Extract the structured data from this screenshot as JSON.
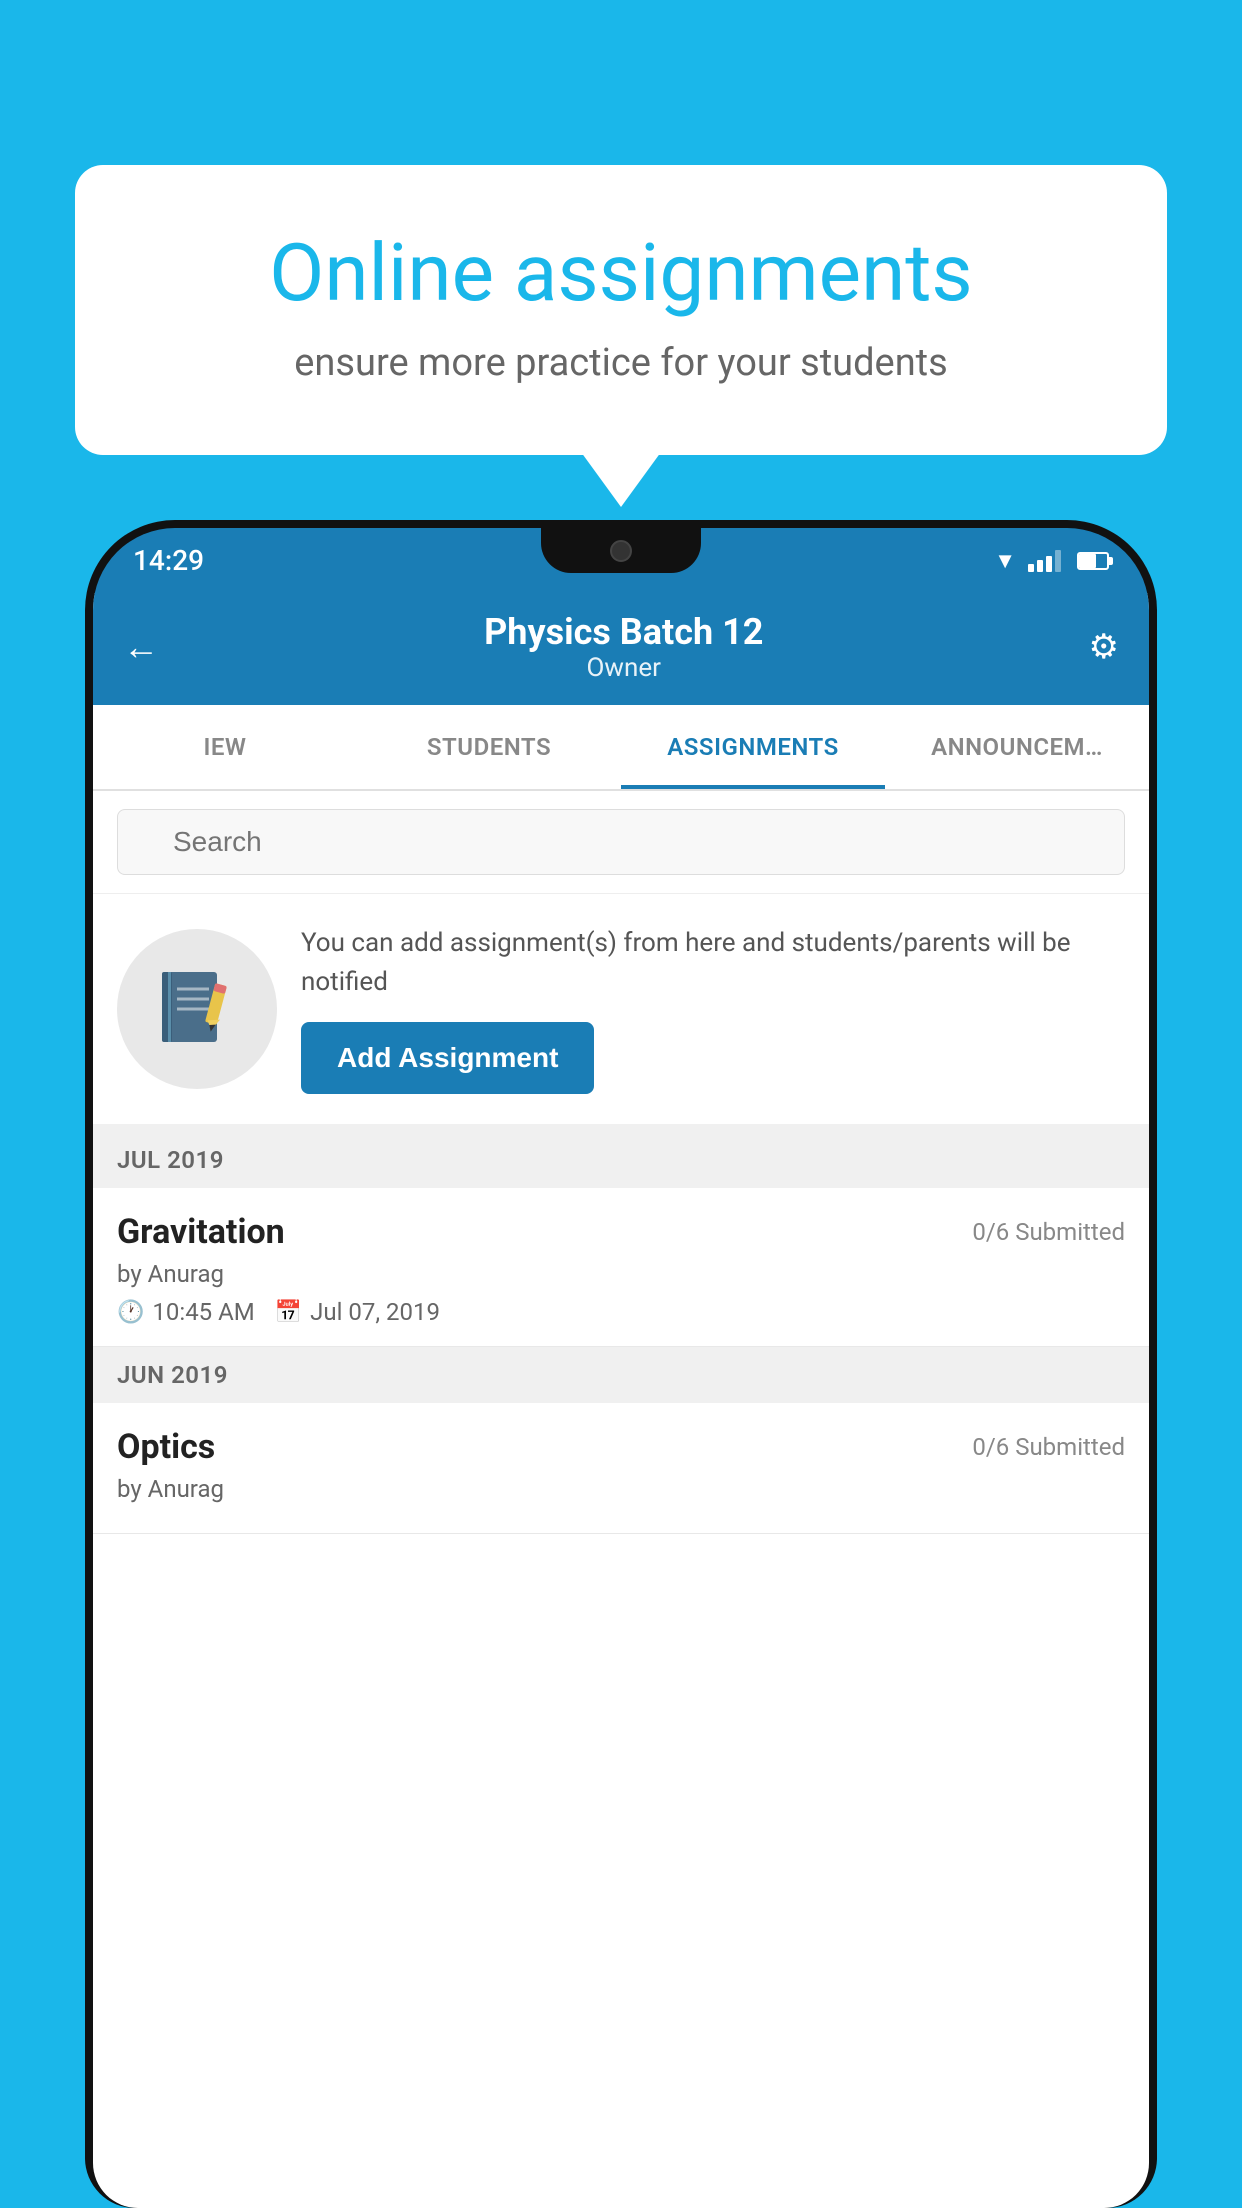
{
  "background_color": "#1ab7ea",
  "speech_bubble": {
    "title": "Online assignments",
    "subtitle": "ensure more practice for your students"
  },
  "status_bar": {
    "time": "14:29"
  },
  "header": {
    "title": "Physics Batch 12",
    "subtitle": "Owner",
    "back_label": "←",
    "settings_label": "⚙"
  },
  "tabs": [
    {
      "label": "IEW",
      "active": false
    },
    {
      "label": "STUDENTS",
      "active": false
    },
    {
      "label": "ASSIGNMENTS",
      "active": true
    },
    {
      "label": "ANNOUNCEM…",
      "active": false
    }
  ],
  "search": {
    "placeholder": "Search"
  },
  "add_assignment_section": {
    "description": "You can add assignment(s) from here and students/parents will be notified",
    "button_label": "Add Assignment"
  },
  "sections": [
    {
      "header": "JUL 2019",
      "assignments": [
        {
          "name": "Gravitation",
          "submitted": "0/6 Submitted",
          "by": "by Anurag",
          "time": "10:45 AM",
          "date": "Jul 07, 2019"
        }
      ]
    },
    {
      "header": "JUN 2019",
      "assignments": [
        {
          "name": "Optics",
          "submitted": "0/6 Submitted",
          "by": "by Anurag",
          "time": "",
          "date": ""
        }
      ]
    }
  ]
}
